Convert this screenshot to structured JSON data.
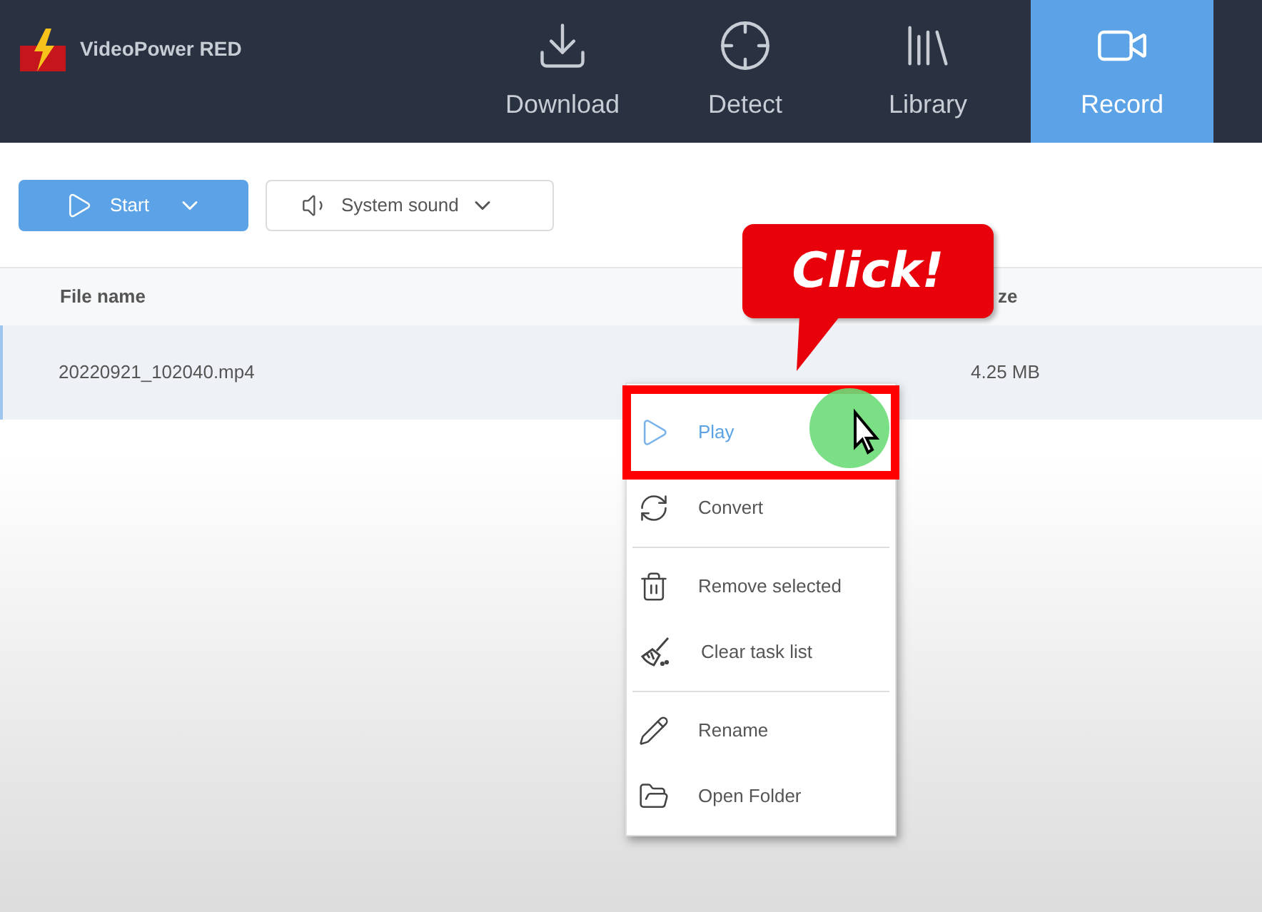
{
  "app": {
    "title": "VideoPower RED"
  },
  "tabs": [
    {
      "label": "Download",
      "selected": false
    },
    {
      "label": "Detect",
      "selected": false
    },
    {
      "label": "Library",
      "selected": false
    },
    {
      "label": "Record",
      "selected": true
    }
  ],
  "toolbar": {
    "start_button": "Start",
    "audio_source": "System sound"
  },
  "table": {
    "columns": [
      "File name",
      "ze"
    ],
    "rows": [
      {
        "cells": [
          "20220921_102040.mp4",
          "4.25 MB"
        ],
        "selected": true
      }
    ]
  },
  "context_menu": {
    "items": [
      {
        "label": "Play",
        "selected": true,
        "divider_before": false
      },
      {
        "label": "Convert",
        "selected": false,
        "divider_before": false
      },
      {
        "label": "Remove selected",
        "selected": false,
        "divider_before": true
      },
      {
        "label": "Clear task list",
        "selected": false,
        "divider_before": false
      },
      {
        "label": "Rename",
        "selected": false,
        "divider_before": true
      },
      {
        "label": "Open Folder",
        "selected": false,
        "divider_before": false
      }
    ]
  },
  "callout": {
    "text": "Click!"
  }
}
